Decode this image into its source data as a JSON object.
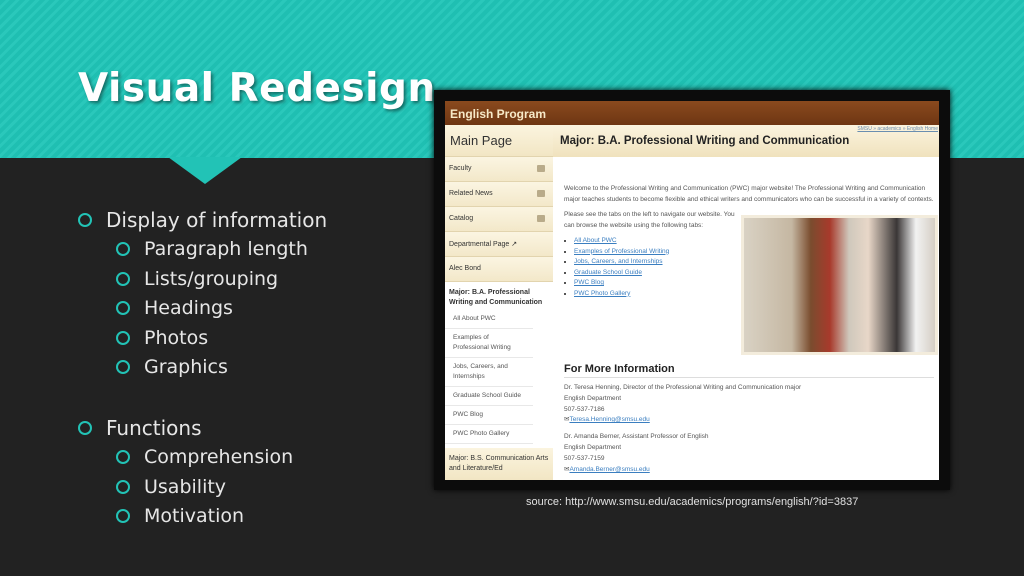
{
  "slide": {
    "title": "Visual Redesign",
    "bullets": [
      {
        "label": "Display of information",
        "children": [
          "Paragraph length",
          "Lists/grouping",
          "Headings",
          "Photos",
          "Graphics"
        ]
      },
      {
        "label": "Functions",
        "children": [
          "Comprehension",
          "Usability",
          "Motivation"
        ]
      }
    ],
    "source": "source: http://www.smsu.edu/academics/programs/english/?id=3837",
    "colors": {
      "accent": "#22c3b6",
      "background": "#222222"
    }
  },
  "website": {
    "header": "English Program",
    "breadcrumb": "SMSU » academics » English Home",
    "sidebar": {
      "main_page": "Main Page",
      "items": [
        {
          "label": "Faculty",
          "icon": "folder-icon"
        },
        {
          "label": "Related News",
          "icon": "comment-icon"
        },
        {
          "label": "Catalog",
          "icon": "book-icon"
        },
        {
          "label": "Departmental Page ↗",
          "icon": "external-link-icon"
        },
        {
          "label": "Alec Bond",
          "icon": ""
        }
      ],
      "section": "Major: B.A. Professional Writing and Communication",
      "subitems": [
        "All About PWC",
        "Examples of Professional Writing",
        "Jobs, Careers, and Internships",
        "Graduate School Guide",
        "PWC Blog",
        "PWC Photo Gallery"
      ],
      "section2": "Major: B.S. Communication Arts and Literature/Ed"
    },
    "page_title": "Major: B.A. Professional Writing and Communication",
    "intro": "Welcome to the Professional Writing and Communication (PWC) major website! The Professional Writing and Communication major teaches students to become flexible and ethical writers and communicators who can be successful in a variety of contexts.",
    "nav_text": "Please see the tabs on the left to navigate our website. You can browse the website using the following tabs:",
    "links": [
      "All About PWC",
      "Examples of Professional Writing",
      "Jobs, Careers, and Internships",
      "Graduate School Guide",
      "PWC Blog",
      "PWC Photo Gallery"
    ],
    "more_heading": "For More Information",
    "contacts": [
      {
        "name": "Dr. Teresa Henning, Director of the Professional Writing and Communication major",
        "dept": "English Department",
        "phone": "507-537-7186",
        "email": "Teresa.Henning@smsu.edu"
      },
      {
        "name": "Dr. Amanda Berner, Assistant Professor of English",
        "dept": "English Department",
        "phone": "507-537-7159",
        "email": "Amanda.Berner@smsu.edu"
      }
    ]
  }
}
